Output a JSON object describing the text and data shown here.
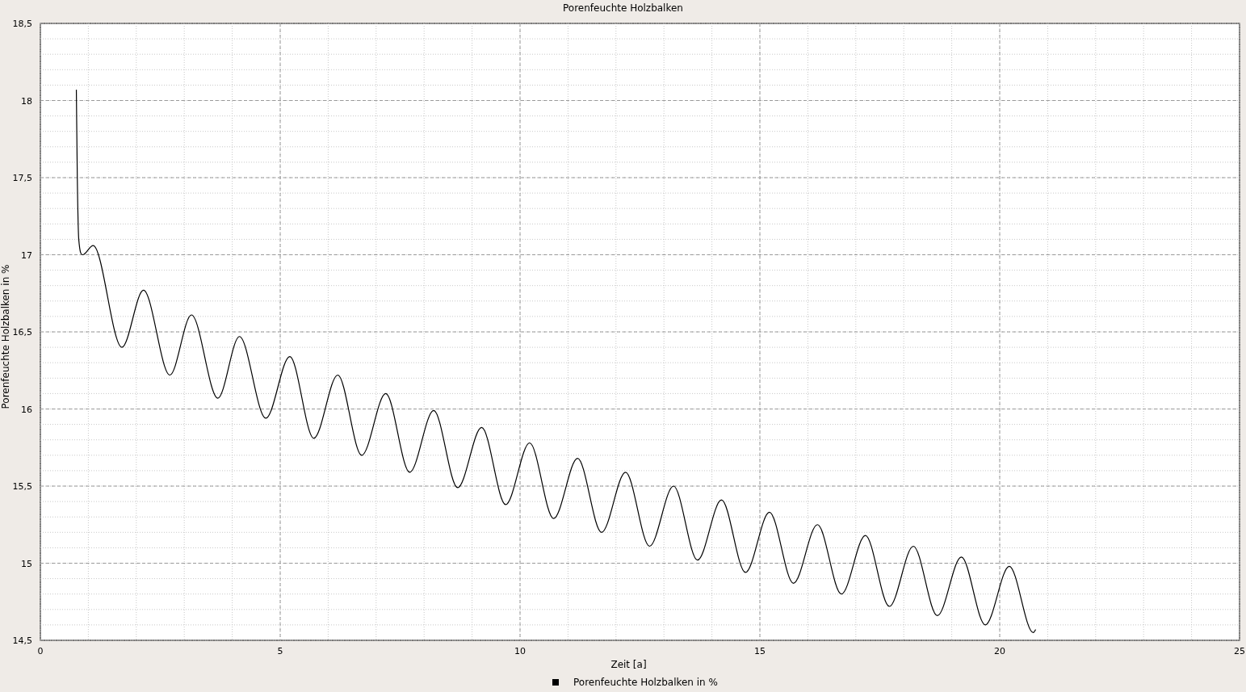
{
  "chart": {
    "chart_data": {
      "type": "line",
      "grid": true,
      "title": "Porenfeuchte Holzbalken",
      "xlabel": "Zeit [a]",
      "ylabel": "Porenfeuchte Holzbalken in %",
      "x": [
        0.75,
        0.77,
        0.8,
        0.88,
        1.1,
        1.7,
        2.15,
        2.7,
        3.15,
        3.7,
        4.15,
        4.7,
        5.2,
        5.7,
        6.2,
        6.7,
        7.2,
        7.7,
        8.2,
        8.7,
        9.2,
        9.7,
        10.2,
        10.7,
        11.2,
        11.7,
        12.2,
        12.7,
        13.2,
        13.7,
        14.2,
        14.7,
        15.2,
        15.7,
        16.2,
        16.7,
        17.2,
        17.7,
        18.2,
        18.7,
        19.2,
        19.7,
        20.2,
        20.7,
        20.75
      ],
      "series": [
        {
          "name": "Porenfeuchte Holzbalken in %",
          "color": "#000000",
          "values": [
            18.07,
            17.5,
            17.1,
            17.0,
            17.06,
            16.4,
            16.77,
            16.22,
            16.61,
            16.07,
            16.47,
            15.94,
            16.34,
            15.81,
            16.22,
            15.7,
            16.1,
            15.59,
            15.99,
            15.49,
            15.88,
            15.38,
            15.78,
            15.29,
            15.68,
            15.2,
            15.59,
            15.11,
            15.5,
            15.02,
            15.41,
            14.94,
            15.33,
            14.87,
            15.25,
            14.8,
            15.18,
            14.72,
            15.11,
            14.66,
            15.04,
            14.6,
            14.98,
            14.55,
            14.57
          ]
        }
      ],
      "xlim": [
        0,
        25
      ],
      "ylim": [
        14.5,
        18.5
      ],
      "xticks": [
        0,
        5,
        10,
        15,
        20,
        25
      ],
      "yticks": [
        {
          "value": 14.5,
          "label": "14,5"
        },
        {
          "value": 15,
          "label": "15"
        },
        {
          "value": 15.5,
          "label": "15,5"
        },
        {
          "value": 16,
          "label": "16"
        },
        {
          "value": 16.5,
          "label": "16,5"
        },
        {
          "value": 17,
          "label": "17"
        },
        {
          "value": 17.5,
          "label": "17,5"
        },
        {
          "value": 18,
          "label": "18"
        },
        {
          "value": 18.5,
          "label": "18,5"
        }
      ]
    }
  }
}
